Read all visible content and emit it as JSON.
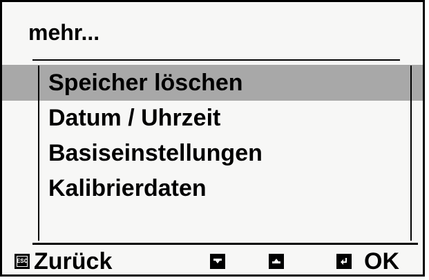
{
  "screen": {
    "title": "mehr...",
    "menu_items": [
      {
        "label": "Speicher löschen",
        "selected": true
      },
      {
        "label": "Datum / Uhrzeit",
        "selected": false
      },
      {
        "label": "Basiseinstellungen",
        "selected": false
      },
      {
        "label": "Kalibrierdaten",
        "selected": false
      }
    ],
    "selection_color": "#a8a8a8"
  },
  "footer": {
    "esc_key": "ESC",
    "back_label": "Zurück",
    "down_icon": "arrow-down-icon",
    "up_icon": "arrow-up-icon",
    "enter_icon": "enter-icon",
    "ok_label": "OK"
  }
}
